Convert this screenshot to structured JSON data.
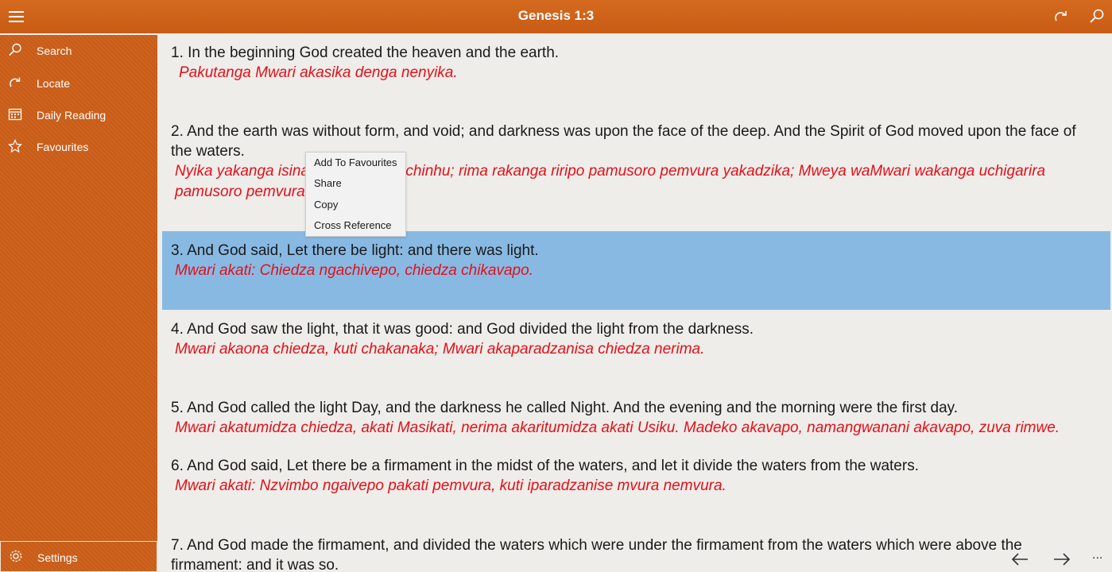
{
  "header": {
    "title": "Genesis 1:3"
  },
  "icons": {
    "menu": "hamburger-icon",
    "refresh": "redo-icon",
    "search": "search-icon"
  },
  "sidebar": {
    "items": [
      {
        "label": "Search",
        "icon": "search-icon"
      },
      {
        "label": "Locate",
        "icon": "redo-icon"
      },
      {
        "label": "Daily Reading",
        "icon": "calendar-icon"
      },
      {
        "label": "Favourites",
        "icon": "star-icon"
      }
    ],
    "settings": {
      "label": "Settings",
      "icon": "gear-icon"
    }
  },
  "verses": [
    {
      "en": "1. In the beginning God created the heaven and the earth.",
      "sn": "Pakutanga Mwari akasika denga nenyika."
    },
    {
      "en": "2. And the earth was without form, and void; and darkness was upon the face of the deep. And the Spirit of God moved upon the face of the waters.",
      "sn": "Nyika yakanga isina chimiro, isina chinhu; rima rakanga riripo pamusoro pemvura yakadzika; Mweya waMwari wakanga uchigarira pamusoro pemvura."
    },
    {
      "en": "3. And God said, Let there be light: and there was light.",
      "sn": "Mwari akati: Chiedza ngachivepo, chiedza chikavapo."
    },
    {
      "en": "4. And God saw the light, that it was good: and God divided the light from the darkness.",
      "sn": "Mwari akaona chiedza, kuti chakanaka; Mwari akaparadzanisa chiedza nerima."
    },
    {
      "en": "5. And God called the light Day, and the darkness he called Night. And the evening and the morning were the first day.",
      "sn": "Mwari akatumidza chiedza, akati Masikati, nerima akaritumidza akati Usiku. Madeko akavapo, namangwanani akavapo, zuva rimwe."
    },
    {
      "en": "6. And God said, Let there be a firmament in the midst of the waters, and let it divide the waters from the waters.",
      "sn": "Mwari akati: Nzvimbo ngaivepo pakati pemvura, kuti iparadzanise mvura nemvura."
    },
    {
      "en": "7. And God made the firmament, and divided the waters which were under the firmament from the waters which were above the firmament: and it was so.",
      "sn": ""
    }
  ],
  "context_menu": {
    "items": [
      "Add To Favourites",
      "Share",
      "Copy",
      "Cross Reference"
    ]
  },
  "bottom_nav": {
    "prev_icon": "arrow-left-icon",
    "next_icon": "arrow-right-icon",
    "more_icon": "more-icon",
    "more_label": "..."
  },
  "colors": {
    "accent": "#cc5f19",
    "selected_verse": "#88b9e3",
    "translation_text": "#e3101a"
  }
}
